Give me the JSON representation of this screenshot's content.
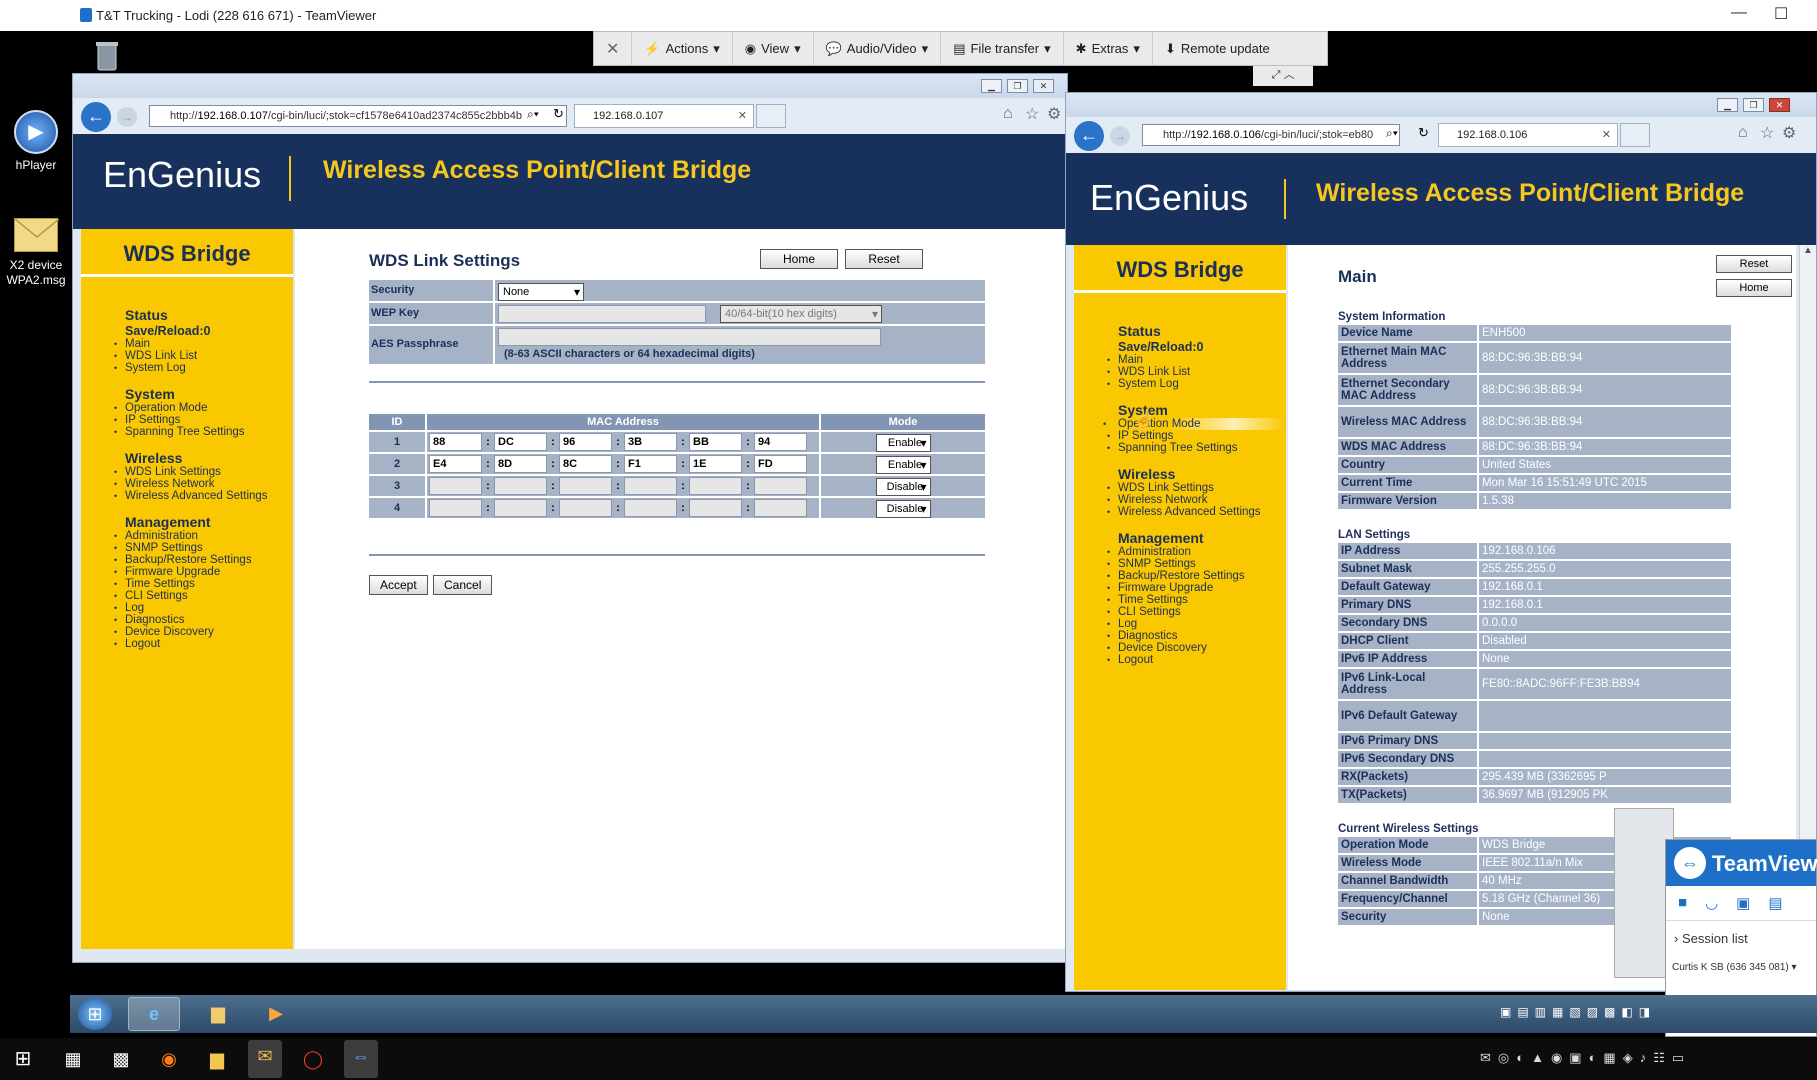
{
  "teamviewer": {
    "title": "T&T Trucking - Lodi (228 616 671) - TeamViewer",
    "toolbar": {
      "close": "✕",
      "actions": "Actions",
      "view": "View",
      "audio_video": "Audio/Video",
      "file_transfer": "File transfer",
      "extras": "Extras",
      "remote_update": "Remote update"
    },
    "panel": {
      "brand": "TeamViewer",
      "session_label": "Session",
      "session_list": "Session list",
      "session_entry": "Curtis K SB (636 345 081)"
    }
  },
  "desktop": {
    "icons": [
      {
        "label": "hPlayer",
        "icon": "media-player-icon"
      },
      {
        "label": "X2 device WPA2.msg",
        "icon": "mail-message-icon"
      }
    ]
  },
  "left_browser": {
    "url_prefix": "http://",
    "url_host": "192.168.0.107",
    "url_rest": "/cgi-bin/luci/;stok=cf1578e6410ad2374c855c2bbb4b",
    "tab_title": "192.168.0.107",
    "header_logo": "EnGenius",
    "header_title": "Wireless Access Point/Client Bridge",
    "side_title": "WDS Bridge",
    "menu": {
      "status": "Status",
      "save_reload": "Save/Reload:0",
      "status_items": [
        "Main",
        "WDS Link List",
        "System Log"
      ],
      "system": "System",
      "system_items": [
        "Operation Mode",
        "IP Settings",
        "Spanning Tree Settings"
      ],
      "wireless": "Wireless",
      "wireless_items": [
        "WDS Link Settings",
        "Wireless Network",
        "Wireless Advanced Settings"
      ],
      "management": "Management",
      "management_items": [
        "Administration",
        "SNMP Settings",
        "Backup/Restore Settings",
        "Firmware Upgrade",
        "Time Settings",
        "CLI Settings",
        "Log",
        "Diagnostics",
        "Device Discovery",
        "Logout"
      ]
    },
    "page_title": "WDS Link Settings",
    "home_button": "Home",
    "reset_button": "Reset",
    "security_label": "Security",
    "security_value": "None",
    "wep_label": "WEP Key",
    "wep_select": "40/64-bit(10 hex digits)",
    "aes_label": "AES Passphrase",
    "aes_hint": "(8-63 ASCII characters or 64 hexadecimal digits)",
    "col_id": "ID",
    "col_mac": "MAC Address",
    "col_mode": "Mode",
    "links": [
      {
        "id": "1",
        "mac": [
          "88",
          "DC",
          "96",
          "3B",
          "BB",
          "94"
        ],
        "mode": "Enable"
      },
      {
        "id": "2",
        "mac": [
          "E4",
          "8D",
          "8C",
          "F1",
          "1E",
          "FD"
        ],
        "mode": "Enable"
      },
      {
        "id": "3",
        "mac": [
          "",
          "",
          "",
          "",
          "",
          ""
        ],
        "mode": "Disable"
      },
      {
        "id": "4",
        "mac": [
          "",
          "",
          "",
          "",
          "",
          ""
        ],
        "mode": "Disable"
      }
    ],
    "accept_button": "Accept",
    "cancel_button": "Cancel"
  },
  "right_browser": {
    "url_prefix": "http://",
    "url_host": "192.168.0.106",
    "url_rest": "/cgi-bin/luci/;stok=eb80",
    "tab_title": "192.168.0.106",
    "header_logo": "EnGenius",
    "header_title": "Wireless Access Point/Client Bridge",
    "side_title": "WDS Bridge",
    "page_title": "Main",
    "reset_button": "Reset",
    "home_button": "Home",
    "sysinfo_title": "System Information",
    "sysinfo": [
      {
        "k": "Device Name",
        "v": "ENH500"
      },
      {
        "k": "Ethernet Main MAC Address",
        "v": "88:DC:96:3B:BB:94"
      },
      {
        "k": "Ethernet Secondary MAC Address",
        "v": "88:DC:96:3B:BB:94"
      },
      {
        "k": "Wireless MAC Address",
        "v": "88:DC:96:3B:BB:94"
      },
      {
        "k": "WDS MAC Address",
        "v": "88:DC:96:3B:BB:94"
      },
      {
        "k": "Country",
        "v": "United States"
      },
      {
        "k": "Current Time",
        "v": "Mon Mar 16 15:51:49 UTC 2015"
      },
      {
        "k": "Firmware Version",
        "v": "1.5.38"
      }
    ],
    "lan_title": "LAN Settings",
    "lan": [
      {
        "k": "IP Address",
        "v": "192.168.0.106"
      },
      {
        "k": "Subnet Mask",
        "v": "255.255.255.0"
      },
      {
        "k": "Default Gateway",
        "v": "192.168.0.1"
      },
      {
        "k": "Primary DNS",
        "v": "192.168.0.1"
      },
      {
        "k": "Secondary DNS",
        "v": "0.0.0.0"
      },
      {
        "k": "DHCP Client",
        "v": "Disabled"
      },
      {
        "k": "IPv6 IP Address",
        "v": "None"
      },
      {
        "k": "IPv6 Link-Local Address",
        "v": "FE80::8ADC:96FF:FE3B:BB94"
      },
      {
        "k": "IPv6 Default Gateway",
        "v": ""
      },
      {
        "k": "IPv6 Primary DNS",
        "v": ""
      },
      {
        "k": "IPv6 Secondary DNS",
        "v": ""
      },
      {
        "k": "RX(Packets)",
        "v": "295.439 MB (3362695 P"
      },
      {
        "k": "TX(Packets)",
        "v": "36.9697 MB (912905 PK"
      }
    ],
    "wireless_title": "Current Wireless Settings",
    "wireless": [
      {
        "k": "Operation Mode",
        "v": "WDS Bridge"
      },
      {
        "k": "Wireless Mode",
        "v": "IEEE 802.11a/n Mix"
      },
      {
        "k": "Channel Bandwidth",
        "v": "40 MHz"
      },
      {
        "k": "Frequency/Channel",
        "v": "5.18 GHz (Channel 36)"
      },
      {
        "k": "Security",
        "v": "None"
      }
    ]
  },
  "colors": {
    "engenius_navy": "#18305c",
    "engenius_yellow": "#fac800",
    "table_cell": "#a6b3c7"
  }
}
